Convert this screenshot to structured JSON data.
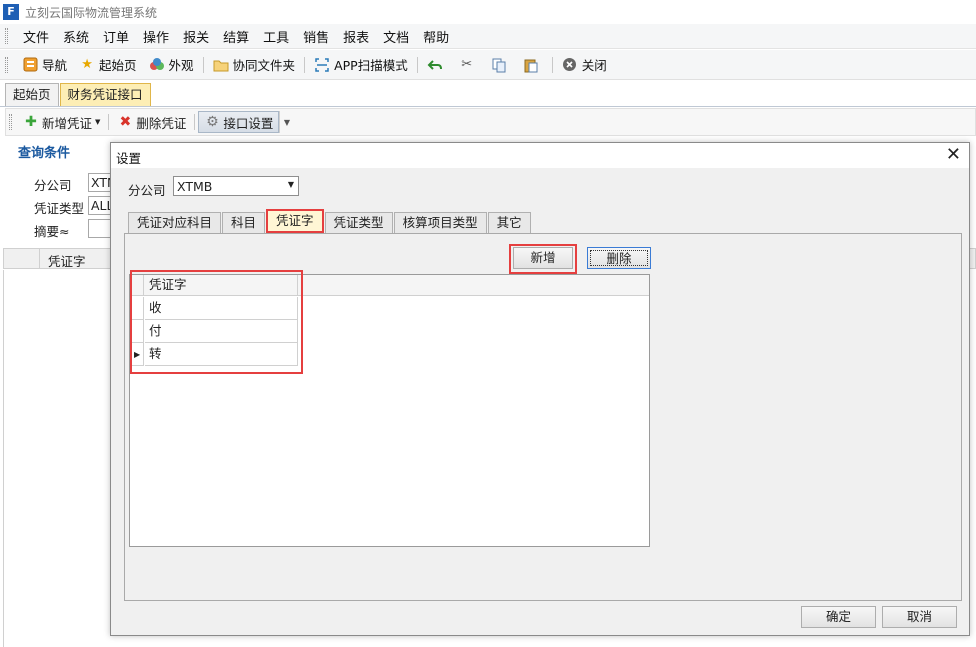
{
  "app": {
    "icon_glyph": "F",
    "title": "立刻云国际物流管理系统"
  },
  "menu": [
    "文件",
    "系统",
    "订单",
    "操作",
    "报关",
    "结算",
    "工具",
    "销售",
    "报表",
    "文档",
    "帮助"
  ],
  "toolbar": {
    "nav": "导航",
    "home": "起始页",
    "appearance": "外观",
    "shared_folder": "协同文件夹",
    "app_scan": "APP扫描模式",
    "close": "关闭",
    "icons": [
      "nav-icon",
      "star-icon",
      "palette-icon",
      "folder-icon",
      "scan-icon",
      "undo-icon",
      "cut-icon",
      "copy-icon",
      "paste-icon",
      "close-circle-icon"
    ]
  },
  "doc_tabs": [
    "起始页",
    "财务凭证接口"
  ],
  "subtoolbar": {
    "add_voucher": "新增凭证",
    "delete_voucher": "删除凭证",
    "interface_settings": "接口设置"
  },
  "query": {
    "title": "查询条件",
    "branch_label": "分公司",
    "branch_value": "XTM",
    "voucher_type_label": "凭证类型",
    "voucher_type_value": "ALL",
    "summary_label": "摘要≈",
    "summary_value": ""
  },
  "main_grid": {
    "column": "凭证字"
  },
  "dialog": {
    "title": "设置",
    "close_glyph": "✕",
    "branch_label": "分公司",
    "branch_value": "XTMB",
    "tabs": [
      "凭证对应科目",
      "科目",
      "凭证字",
      "凭证类型",
      "核算项目类型",
      "其它"
    ],
    "active_tab": 2,
    "add_button": "新增",
    "delete_button": "删除",
    "grid": {
      "header": "凭证字",
      "rows": [
        "收",
        "付",
        "转"
      ],
      "current_row": 2
    },
    "ok_button": "确定",
    "cancel_button": "取消"
  },
  "colors": {
    "accent_blue": "#1c5aa0",
    "highlight_red": "#e53f3f",
    "active_tab": "#fdeeb5"
  }
}
